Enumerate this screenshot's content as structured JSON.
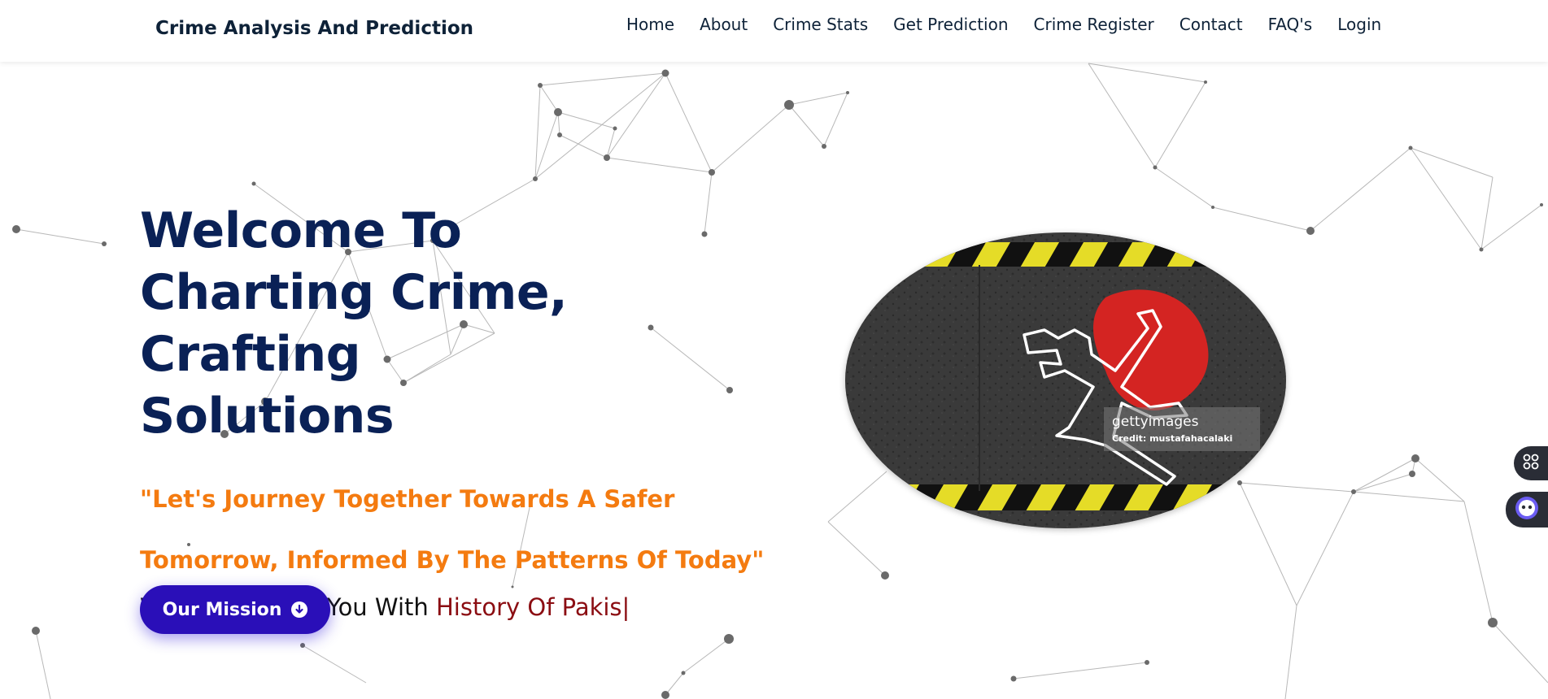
{
  "brand": "Crime Analysis And Prediction",
  "nav": [
    "Home",
    "About",
    "Crime Stats",
    "Get Prediction",
    "Crime Register",
    "Contact",
    "FAQ's",
    "Login"
  ],
  "hero": {
    "title_line1": "Welcome To",
    "title_line2": "Charting Crime, Crafting",
    "title_line3": "Solutions",
    "tagline": "\"Let's Journey Together Towards A Safer Tomorrow, Informed By The Patterns Of Today\"",
    "typing_prefix": "We Will Update You With ",
    "typing_text": "History Of Pakis|",
    "button_label": "Our Mission"
  },
  "image": {
    "watermark_logo": "gettyimages",
    "watermark_credit": "Credit: mustafahacalaki"
  },
  "icons": {
    "mission_button": "arrow-down-circle-icon",
    "side_widget_1": "apps-grid-icon",
    "side_widget_2": "chatbot-icon"
  },
  "colors": {
    "title": "#0a2156",
    "tagline": "#f47b10",
    "typed_text": "#8b0d12",
    "button": "#2a0fb8"
  }
}
